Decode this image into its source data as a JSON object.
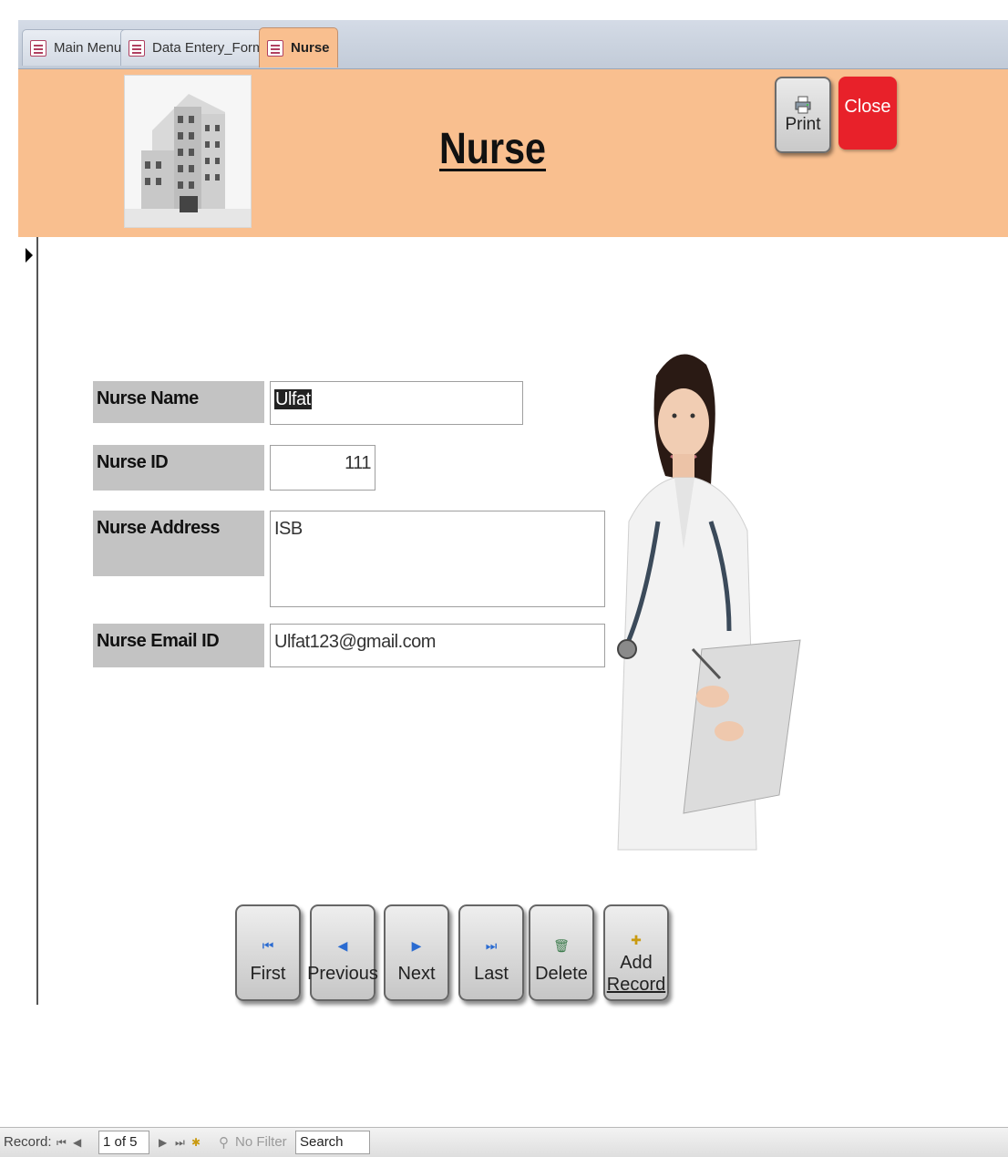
{
  "tabs": [
    {
      "label": "Main Menu",
      "active": false
    },
    {
      "label": "Data Entery_Forms",
      "active": false
    },
    {
      "label": "Nurse",
      "active": true
    }
  ],
  "header": {
    "title": "Nurse",
    "print_label": "Print",
    "close_label": "Close",
    "background_color": "#f9bf8f",
    "close_color": "#e8212a"
  },
  "form": {
    "nurse_name": {
      "label": "Nurse Name",
      "value_selected": "Ulfat"
    },
    "nurse_id": {
      "label": "Nurse ID",
      "value": "111"
    },
    "nurse_address": {
      "label": "Nurse Address",
      "value": "ISB"
    },
    "nurse_email": {
      "label": "Nurse Email ID",
      "value": "Ulfat123@gmail.com"
    }
  },
  "nav_buttons": {
    "first": "First",
    "previous": "Previous",
    "next": "Next",
    "last": "Last",
    "delete": "Delete",
    "add_record_line1": "Add",
    "add_record_line2": "Record"
  },
  "statusbar": {
    "record_label": "Record:",
    "record_position": "1 of 5",
    "filter_label": "No Filter",
    "search_label": "Search"
  }
}
